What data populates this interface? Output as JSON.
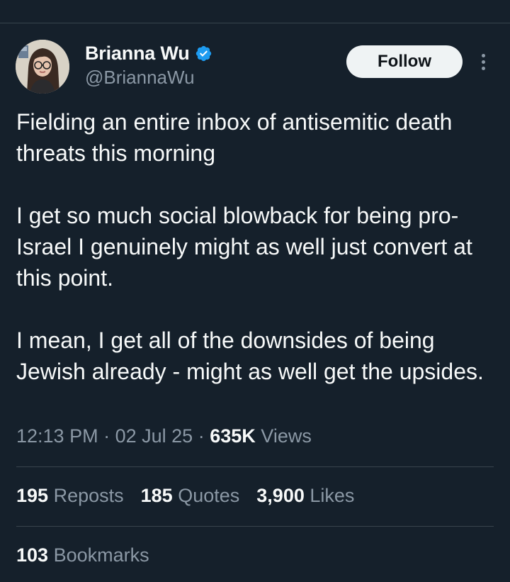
{
  "author": {
    "display_name": "Brianna Wu",
    "handle": "@BriannaWu",
    "verified": true,
    "verified_icon": "verified-badge-icon",
    "avatar": "profile-photo"
  },
  "actions": {
    "follow_label": "Follow",
    "more_icon": "more-vertical-icon"
  },
  "tweet": {
    "paragraphs": [
      "Fielding an entire inbox of antisemitic death threats this morning",
      "I get so much social blowback for being pro-Israel I genuinely might as well just convert at this point.",
      "I mean, I get all of the downsides of being Jewish already - might as well get the upsides."
    ],
    "time": "12:13 PM",
    "separator": "·",
    "date": "02 Jul 25",
    "views_count": "635K",
    "views_label": "Views"
  },
  "stats": {
    "reposts": {
      "count": "195",
      "label": "Reposts"
    },
    "quotes": {
      "count": "185",
      "label": "Quotes"
    },
    "likes": {
      "count": "3,900",
      "label": "Likes"
    },
    "bookmarks": {
      "count": "103",
      "label": "Bookmarks"
    }
  },
  "colors": {
    "background": "#15202b",
    "text_primary": "#f7f9f9",
    "text_secondary": "#8b98a5",
    "divider": "#38444d",
    "verified_blue": "#1d9bf0",
    "follow_button_bg": "#eff3f4"
  }
}
